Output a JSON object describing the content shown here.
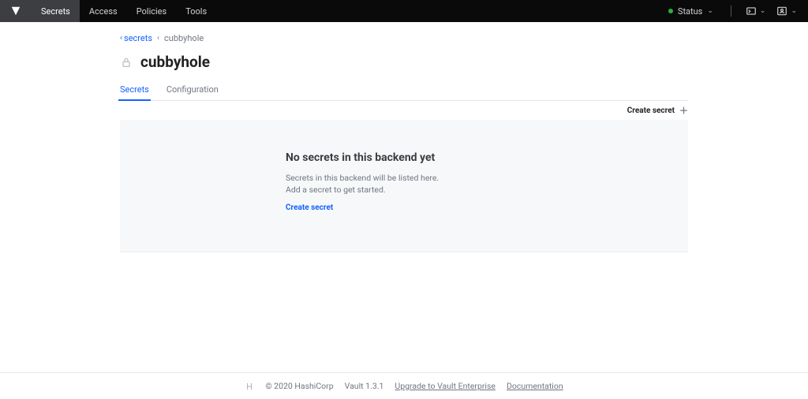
{
  "nav": {
    "items": [
      "Secrets",
      "Access",
      "Policies",
      "Tools"
    ],
    "status_label": "Status"
  },
  "breadcrumb": {
    "parent": "secrets",
    "current": "cubbyhole"
  },
  "page": {
    "title": "cubbyhole",
    "tabs": [
      "Secrets",
      "Configuration"
    ]
  },
  "toolbar": {
    "create_secret": "Create secret"
  },
  "empty": {
    "title": "No secrets in this backend yet",
    "description": "Secrets in this backend will be listed here. Add a secret to get started.",
    "link": "Create secret"
  },
  "footer": {
    "copyright": "© 2020 HashiCorp",
    "version": "Vault 1.3.1",
    "upgrade": "Upgrade to Vault Enterprise",
    "documentation": "Documentation"
  }
}
